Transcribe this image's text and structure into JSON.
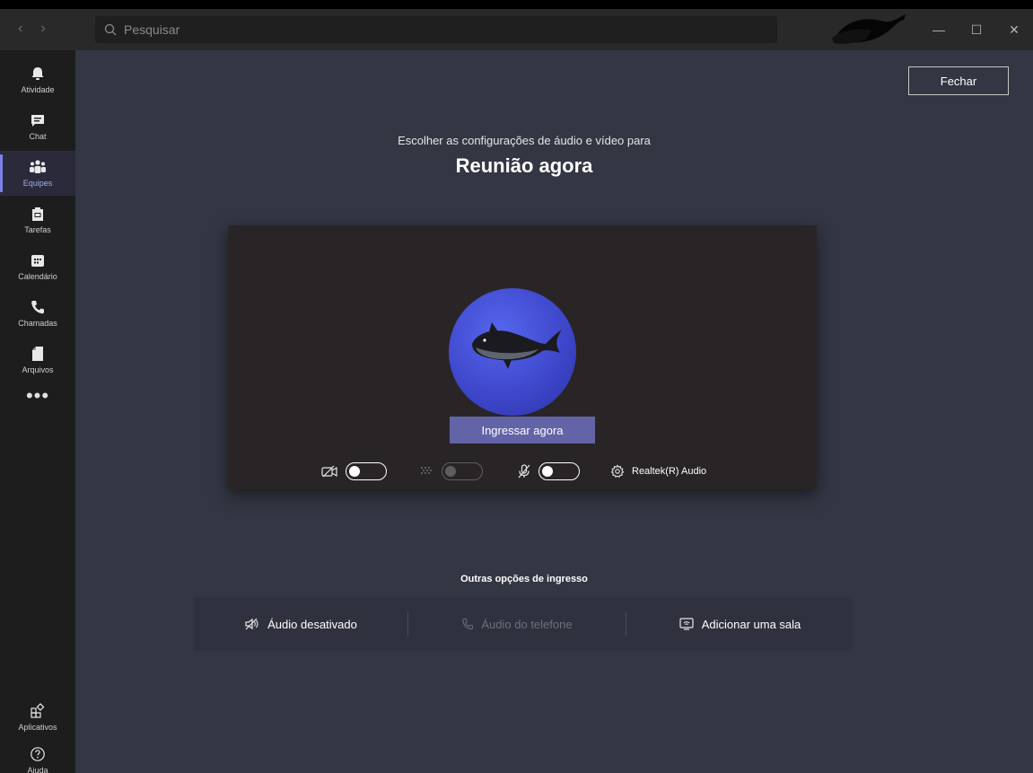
{
  "titlebar": {
    "search_placeholder": "Pesquisar",
    "nav_back": "‹",
    "nav_forward": "›",
    "minimize": "—",
    "maximize": "☐",
    "close": "✕"
  },
  "appbar": {
    "items": [
      {
        "label": "Atividade",
        "icon": "bell-icon"
      },
      {
        "label": "Chat",
        "icon": "chat-icon"
      },
      {
        "label": "Equipes",
        "icon": "teams-icon",
        "active": true
      },
      {
        "label": "Tarefas",
        "icon": "tasks-icon"
      },
      {
        "label": "Calendário",
        "icon": "calendar-icon"
      },
      {
        "label": "Chamadas",
        "icon": "phone-icon"
      },
      {
        "label": "Arquivos",
        "icon": "file-icon"
      }
    ],
    "more": "•••",
    "bottom_items": [
      {
        "label": "Aplicativos",
        "icon": "apps-icon"
      },
      {
        "label": "Ajuda",
        "icon": "help-icon"
      }
    ]
  },
  "main": {
    "close_label": "Fechar",
    "subtitle": "Escolher as configurações de áudio e vídeo para",
    "meeting_title": "Reunião agora",
    "join_label": "Ingressar agora",
    "audio_device": "Realtek(R) Audio",
    "other_title": "Outras opções de ingresso",
    "other_options": {
      "audio_off": "Áudio desativado",
      "phone_audio": "Áudio do telefone",
      "add_room": "Adicionar uma sala"
    }
  },
  "colors": {
    "accent": "#6264a7",
    "main_bg": "#333643",
    "preview_bg": "#292526",
    "avatar_blue": "#3f48cc"
  }
}
